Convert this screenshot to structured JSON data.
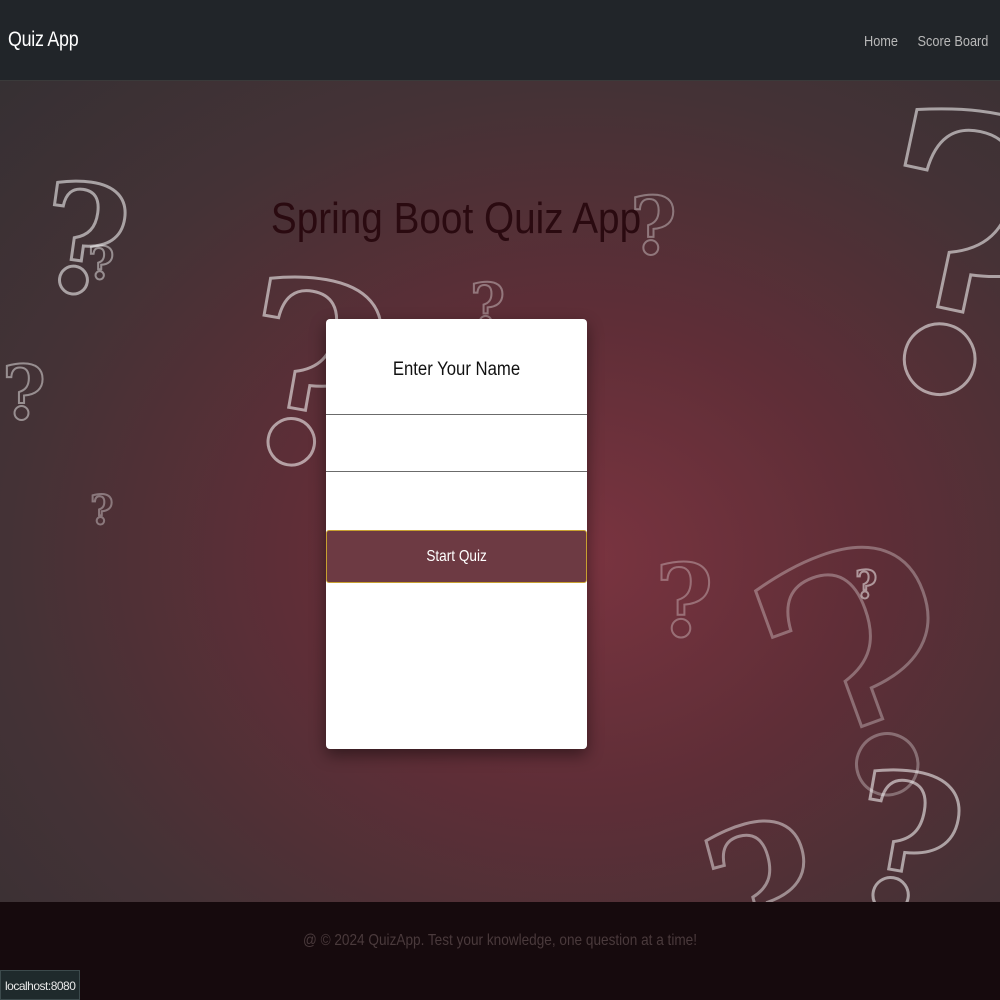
{
  "navbar": {
    "brand": "Quiz App",
    "links": [
      {
        "label": "Home"
      },
      {
        "label": "Score Board"
      }
    ]
  },
  "hero": {
    "title": "Spring Boot Quiz App"
  },
  "form": {
    "label": "Enter Your Name",
    "name_value": "",
    "submit_label": "Start Quiz"
  },
  "footer": {
    "text": "@ © 2024 QuizApp. Test your knowledge, one question at a time!"
  },
  "status_bar": {
    "url": "localhost:8080"
  },
  "colors": {
    "navbar_bg": "#212529",
    "button_bg": "#6d3a43",
    "button_border": "#c8a030",
    "title_color": "#2a0a10",
    "footer_bg": "#160a0d"
  },
  "icons": {
    "background_decoration": "question-mark-icon"
  }
}
